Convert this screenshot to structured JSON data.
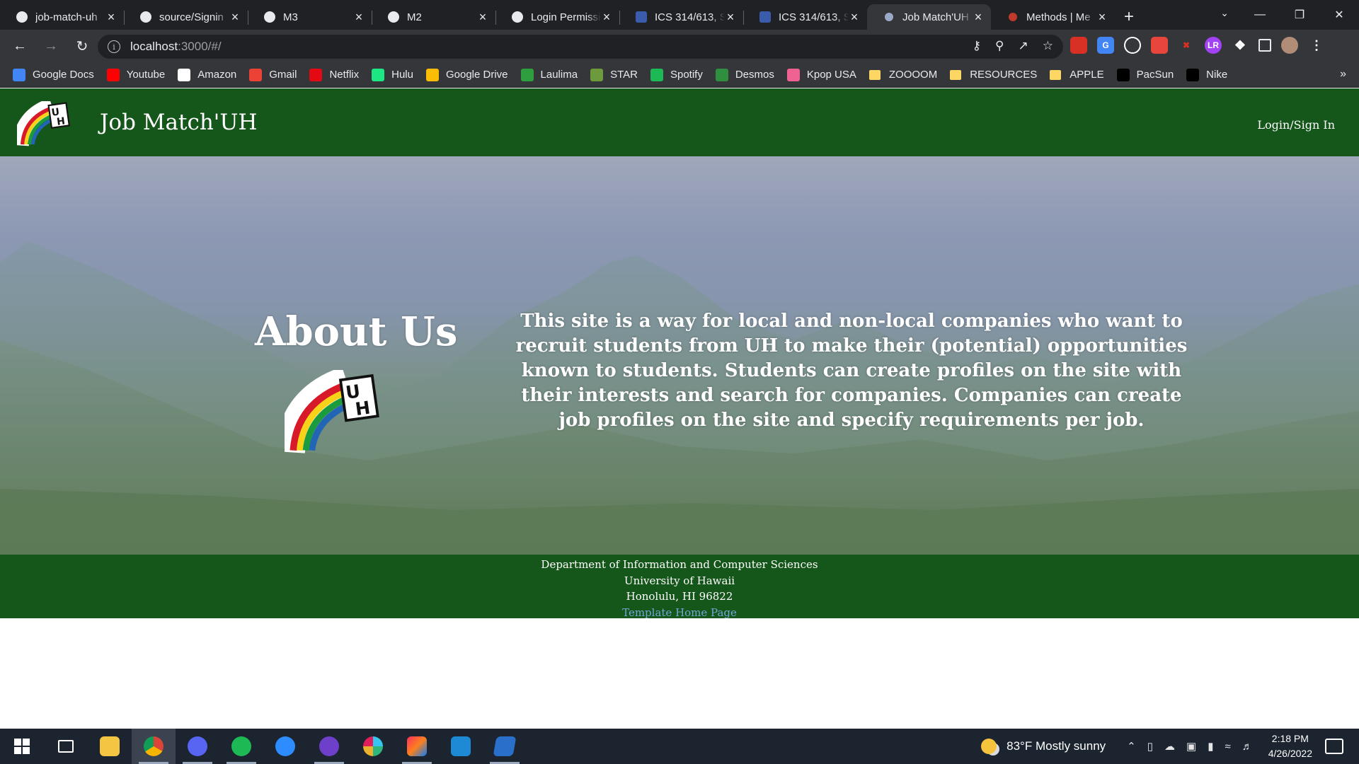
{
  "browser": {
    "tabs": [
      {
        "title": "job-match-uh",
        "icon": "github-icon"
      },
      {
        "title": "source/Signin",
        "icon": "github-icon"
      },
      {
        "title": "M3",
        "icon": "github-icon"
      },
      {
        "title": "M2",
        "icon": "github-icon"
      },
      {
        "title": "Login Permissi",
        "icon": "github-icon"
      },
      {
        "title": "ICS 314/613, S",
        "icon": "course-icon"
      },
      {
        "title": "ICS 314/613, S",
        "icon": "course-icon"
      },
      {
        "title": "Job Match'UH",
        "icon": "meteor-icon",
        "active": true
      },
      {
        "title": "Methods | Me",
        "icon": "meteor-red-icon"
      }
    ],
    "address": {
      "host": "localhost",
      "path": ":3000/#/"
    },
    "bookmarks": [
      {
        "label": "Google Docs",
        "icon": "docs-icon",
        "color": "#4285f4"
      },
      {
        "label": "Youtube",
        "icon": "youtube-icon",
        "color": "#ff0000"
      },
      {
        "label": "Amazon",
        "icon": "amazon-icon",
        "color": "#ffffff"
      },
      {
        "label": "Gmail",
        "icon": "gmail-icon",
        "color": "#ea4335"
      },
      {
        "label": "Netflix",
        "icon": "netflix-icon",
        "color": "#e50914"
      },
      {
        "label": "Hulu",
        "icon": "hulu-icon",
        "color": "#1ce783"
      },
      {
        "label": "Google Drive",
        "icon": "drive-icon",
        "color": "#fbbc04"
      },
      {
        "label": "Laulima",
        "icon": "laulima-icon",
        "color": "#2e9e3f"
      },
      {
        "label": "STAR",
        "icon": "star-icon",
        "color": "#6c9a3d"
      },
      {
        "label": "Spotify",
        "icon": "spotify-icon",
        "color": "#1db954"
      },
      {
        "label": "Desmos",
        "icon": "desmos-icon",
        "color": "#2f8f3f"
      },
      {
        "label": "Kpop USA",
        "icon": "kpop-icon",
        "color": "#f06292"
      },
      {
        "label": "ZOOOOM",
        "icon": "folder-icon",
        "color": "#fdd663"
      },
      {
        "label": "RESOURCES",
        "icon": "folder-icon",
        "color": "#fdd663"
      },
      {
        "label": "APPLE",
        "icon": "folder-icon",
        "color": "#fdd663"
      },
      {
        "label": "PacSun",
        "icon": "pacsun-icon",
        "color": "#000000"
      },
      {
        "label": "Nike",
        "icon": "nike-icon",
        "color": "#000000"
      }
    ]
  },
  "site": {
    "brand": "Job Match'UH",
    "login_label": "Login/Sign In",
    "colors": {
      "nav": "#15561a",
      "footer": "#15561a",
      "link": "#6fa7d6"
    },
    "about": {
      "title": "About Us",
      "text": "This site is a way for local and non-local companies who want to recruit students from UH to make their (potential) opportunities known to students. Students can create profiles on the site with their interests and search for companies. Companies can create job profiles on the site and specify requirements per job."
    },
    "footer": {
      "line1": "Department of Information and Computer Sciences",
      "line2": "University of Hawaii",
      "line3": "Honolulu, HI 96822",
      "link": "Template Home Page"
    }
  },
  "taskbar": {
    "weather": "83°F  Mostly sunny",
    "time": "2:18 PM",
    "date": "4/26/2022"
  }
}
